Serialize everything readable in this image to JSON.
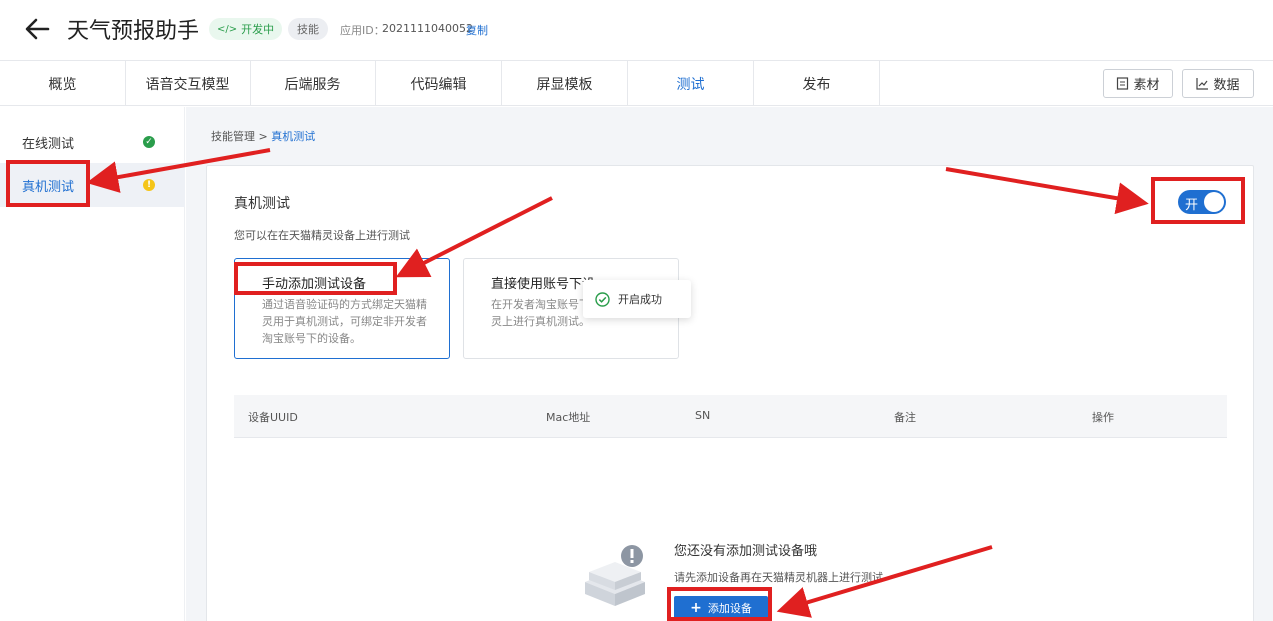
{
  "header": {
    "title": "天气预报助手",
    "dev_badge": "开发中",
    "skill_badge": "技能",
    "app_id_label": "应用ID：",
    "app_id": "2021111040052",
    "copy_label": "复制"
  },
  "tabs": [
    {
      "label": "概览"
    },
    {
      "label": "语音交互模型"
    },
    {
      "label": "后端服务"
    },
    {
      "label": "代码编辑"
    },
    {
      "label": "屏显模板"
    },
    {
      "label": "测试",
      "active": true
    },
    {
      "label": "发布"
    }
  ],
  "toolbar": {
    "materials_label": "素材",
    "data_label": "数据"
  },
  "sidebar": {
    "items": [
      {
        "label": "在线测试",
        "status": "success"
      },
      {
        "label": "真机测试",
        "status": "warning",
        "active": true
      }
    ]
  },
  "breadcrumb": {
    "parent": "技能管理",
    "separator": ">",
    "current": "真机测试"
  },
  "card": {
    "title": "真机测试",
    "description": "您可以在在天猫精灵设备上进行测试",
    "switch_label": "开",
    "switch_on": true
  },
  "options": [
    {
      "title": "手动添加测试设备",
      "desc": "通过语音验证码的方式绑定天猫精灵用于真机测试，可绑定非开发者淘宝账号下的设备。",
      "selected": true
    },
    {
      "title": "直接使用账号下设",
      "desc": "在开发者淘宝账号下灵上进行真机测试。",
      "selected": false
    }
  ],
  "toast": {
    "text": "开启成功"
  },
  "table": {
    "columns": [
      "设备UUID",
      "Mac地址",
      "SN",
      "备注",
      "操作"
    ]
  },
  "empty": {
    "title": "您还没有添加测试设备哦",
    "desc": "请先添加设备再在天猫精灵机器上进行测试",
    "add_button": "添加设备"
  },
  "colors": {
    "accent": "#1f6fd1",
    "success": "#2a9d4b",
    "warning": "#f5c518",
    "annotation": "#e02020"
  }
}
